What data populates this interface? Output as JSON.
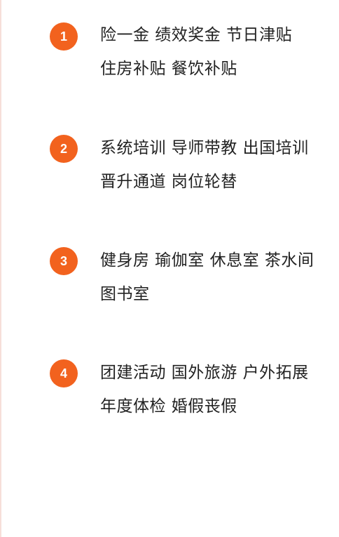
{
  "benefits": [
    {
      "number": "1",
      "lines": [
        "险一金 绩效奖金 节日津贴",
        "住房补贴 餐饮补贴"
      ]
    },
    {
      "number": "2",
      "lines": [
        "系统培训 导师带教 出国培训",
        "晋升通道 岗位轮替"
      ]
    },
    {
      "number": "3",
      "lines": [
        "健身房 瑜伽室 休息室 茶水间",
        "图书室"
      ]
    },
    {
      "number": "4",
      "lines": [
        "团建活动 国外旅游 户外拓展",
        "年度体检 婚假丧假"
      ]
    }
  ],
  "colors": {
    "badge": "#f2621e",
    "text": "#222222",
    "rule": "#f6dfd9"
  }
}
